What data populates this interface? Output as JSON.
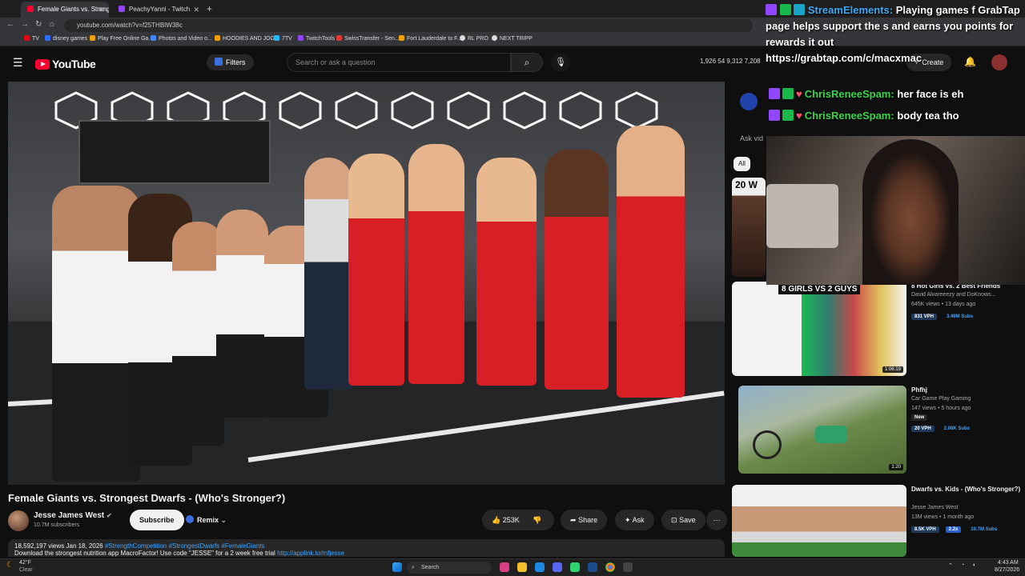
{
  "browser": {
    "tabs": [
      {
        "title": "Female Giants vs. Strongest Dw",
        "color": "#ff0033"
      },
      {
        "title": "PeachyYanni - Twitch",
        "color": "#9146ff"
      }
    ],
    "url": "youtube.com/watch?v=f25THBIW38c",
    "bookmarks": [
      "TV",
      "disney games",
      "Play Free Online Ga...",
      "Photos and Video o...",
      "HOODIES AND JOG...",
      "7TV",
      "TwitchTools",
      "SwissTransfer - Sen...",
      "Fort Lauderdale to F...",
      "RL PRO",
      "NEXT TRIPP"
    ]
  },
  "masthead": {
    "logo": "YouTube",
    "filters_label": "Filters",
    "search_placeholder": "Search or ask a question",
    "stats": "1,926  54  9,312  7,208",
    "create_label": "Create"
  },
  "video": {
    "title": "Female Giants vs. Strongest Dwarfs - (Who's Stronger?)",
    "channel": "Jesse James West",
    "subscribers": "10.7M subscribers",
    "subscribe_label": "Subscribe",
    "remix_label": "Remix",
    "likes": "253K",
    "share_label": "Share",
    "ask_label": "Ask",
    "save_label": "Save",
    "views_date": "18,592,197 views  Jan 18, 2026",
    "hashtags": "#StrengthCompetition #StrongestDwarfs #FemaleGiants",
    "description_line": "Download the strongest nutrition app MacroFactor! Use code \"JESSE\" for a 2 week free trial",
    "description_link": "http://applink.to/mfjesse"
  },
  "sidebar": {
    "ask_placeholder": "Ask vid",
    "chip_all": "All",
    "recommendations": [
      {
        "title": "8 Hot Girls vs. 2 Best Friends",
        "channel": "David Alvareeezy  and DoKnows...",
        "meta": "645K views • 13 days ago",
        "vph": "831 VPH",
        "subs": "3.49M Subs",
        "duration": "1:06:19",
        "thumb_text": "8 GIRLS VS 2 GUYS"
      },
      {
        "title": "Phfhj",
        "channel": "Car Game Play Gaming",
        "meta": "147 views • 5 hours ago",
        "vph": "20 VPH",
        "subs": "2.08K Subs",
        "duration": "1:20",
        "new_label": "New"
      },
      {
        "title": "Dwarfs vs. Kids - (Who's Stronger?)",
        "channel": "Jesse James West",
        "meta": "13M views • 1 month ago",
        "vph": "8.5K VPH",
        "ratio": "2.2x",
        "subs": "10.7M Subs"
      }
    ],
    "partial_thumb_text": "20 W"
  },
  "overlay": {
    "chat_header_user": "StreamElements:",
    "chat_header_text": "Playing games f GrabTap page helps support the s and earns you points for rewards it out",
    "chat_header_link": "https://grabtap.com/c/macxmac",
    "messages": [
      {
        "user": "ChrisReneeSpam:",
        "text": "her face is eh"
      },
      {
        "user": "ChrisReneeSpam:",
        "text": "body tea tho"
      }
    ]
  },
  "taskbar": {
    "weather_temp": "42°F",
    "weather_text": "Clear",
    "search_label": "Search",
    "time": "4:43 AM",
    "date": "8/27/2026"
  }
}
